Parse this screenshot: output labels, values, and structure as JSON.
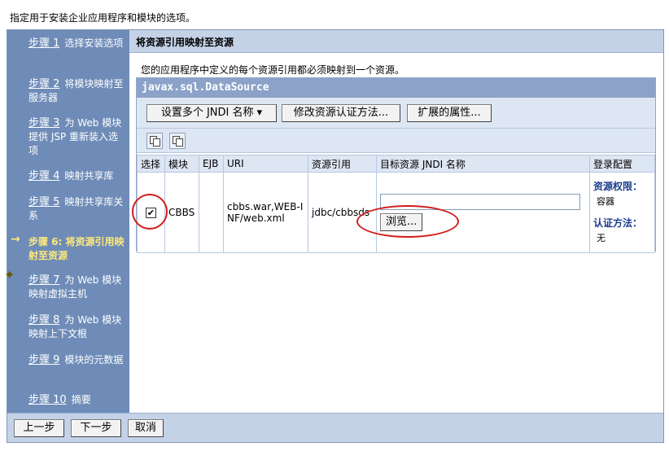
{
  "intro": "指定用于安装企业应用程序和模块的选项。",
  "steps": [
    {
      "link": "步骤 1",
      "text": "选择安装选项"
    },
    {
      "link": "步骤 2",
      "text": "将模块映射至服务器"
    },
    {
      "link": "步骤 3",
      "text": "为 Web 模块提供 JSP 重新装入选项"
    },
    {
      "link": "步骤 4",
      "text": "映射共享库"
    },
    {
      "link": "步骤 5",
      "text": "映射共享库关系"
    },
    {
      "link": "",
      "text": "步骤 6: 将资源引用映射至资源"
    },
    {
      "link": "步骤 7",
      "text": "为 Web 模块映射虚拟主机"
    },
    {
      "link": "步骤 8",
      "text": "为 Web 模块映射上下文根"
    },
    {
      "link": "步骤 9",
      "text": "模块的元数据"
    },
    {
      "link": "步骤 10",
      "text": "摘要"
    }
  ],
  "current_marker": "→",
  "star_marker": "✦",
  "main": {
    "title": "将资源引用映射至资源",
    "description": "您的应用程序中定义的每个资源引用都必须映射到一个资源。",
    "panel_title": "javax.sql.DataSource",
    "toolbar": {
      "set_jndi": "设置多个 JNDI 名称",
      "set_jndi_caret": "▾",
      "modify_auth": "修改资源认证方法...",
      "extended_props": "扩展的属性..."
    },
    "icons": [
      "select-all-icon",
      "deselect-all-icon"
    ],
    "columns": [
      "选择",
      "模块",
      "EJB",
      "URI",
      "资源引用",
      "目标资源 JNDI 名称",
      "登录配置"
    ],
    "row": {
      "checked_mark": "✔",
      "module": "CBBS",
      "ejb": "",
      "uri": "cbbs.war,WEB-INF/web.xml",
      "resource_ref": "jdbc/cbbsds",
      "jndi_value": "",
      "browse": "浏览...",
      "auth_perm_label": "资源权限：",
      "auth_perm_value": "容器",
      "auth_method_label": "认证方法：",
      "auth_method_value": "无"
    }
  },
  "footer": {
    "prev": "上一步",
    "next": "下一步",
    "cancel": "取消"
  },
  "colors": {
    "sidebar": "#6f8cb8",
    "current_step": "#ffe97a",
    "panel_header": "#8ca2c8",
    "annotation": "#d31b1b"
  }
}
